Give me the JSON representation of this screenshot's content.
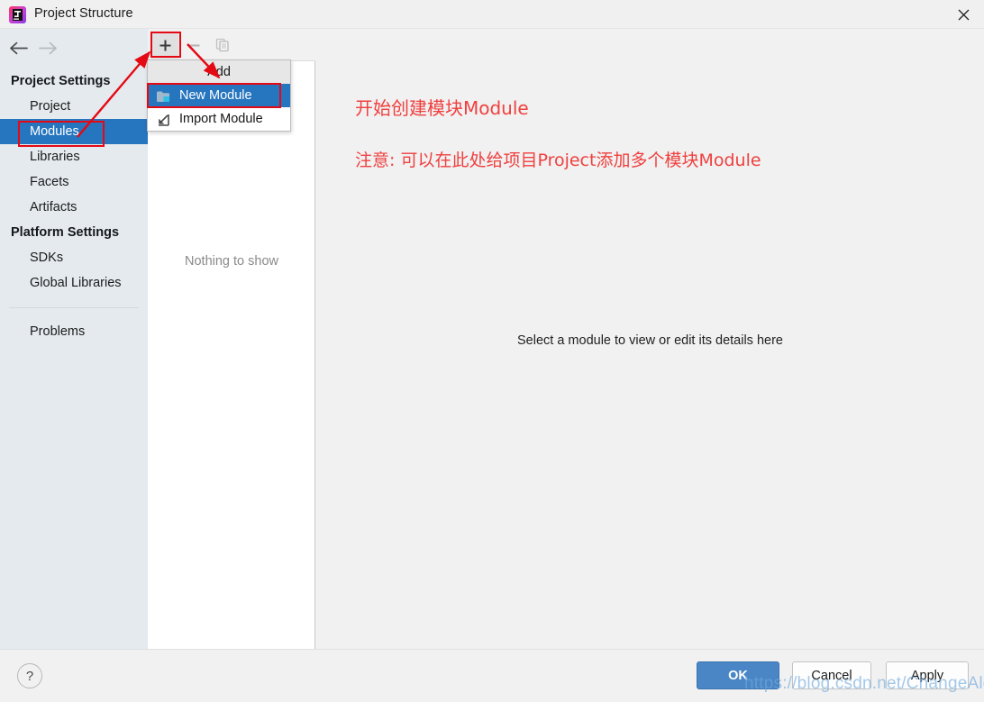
{
  "window": {
    "title": "Project Structure",
    "app_icon": "intellij-idea-logo",
    "close_icon": "close-icon"
  },
  "nav": {
    "back_icon": "arrow-left-icon",
    "forward_icon": "arrow-right-icon"
  },
  "sidebar": {
    "groups": [
      {
        "label": "Project Settings",
        "items": [
          {
            "label": "Project",
            "selected": false
          },
          {
            "label": "Modules",
            "selected": true
          },
          {
            "label": "Libraries",
            "selected": false
          },
          {
            "label": "Facets",
            "selected": false
          },
          {
            "label": "Artifacts",
            "selected": false
          }
        ]
      },
      {
        "label": "Platform Settings",
        "items": [
          {
            "label": "SDKs",
            "selected": false
          },
          {
            "label": "Global Libraries",
            "selected": false
          }
        ]
      }
    ],
    "extra_items": [
      {
        "label": "Problems",
        "selected": false
      }
    ]
  },
  "modules_panel": {
    "toolbar": {
      "add_icon": "plus-icon",
      "remove_icon": "minus-icon",
      "copy_icon": "copy-icon"
    },
    "empty_text": "Nothing to show"
  },
  "popup_menu": {
    "header": "Add",
    "items": [
      {
        "label": "New Module",
        "icon": "folder-add-icon",
        "highlighted": true
      },
      {
        "label": "Import Module",
        "icon": "import-arrow-icon",
        "highlighted": false
      }
    ]
  },
  "detail_panel": {
    "hint": "Select a module to view or edit its details here",
    "annotations": [
      "开始创建模块Module",
      "注意: 可以在此处给项目Project添加多个模块Module"
    ]
  },
  "footer": {
    "help_label": "?",
    "ok_label": "OK",
    "cancel_label": "Cancel",
    "apply_label": "Apply"
  },
  "watermark": "https://blog.csdn.net/ChangeAlone",
  "colors": {
    "selection_blue": "#2675bf",
    "ok_button": "#4a86c5",
    "annotation_red": "#f04040",
    "callout_red": "#e50914",
    "sidebar_bg": "#e4eaee"
  }
}
